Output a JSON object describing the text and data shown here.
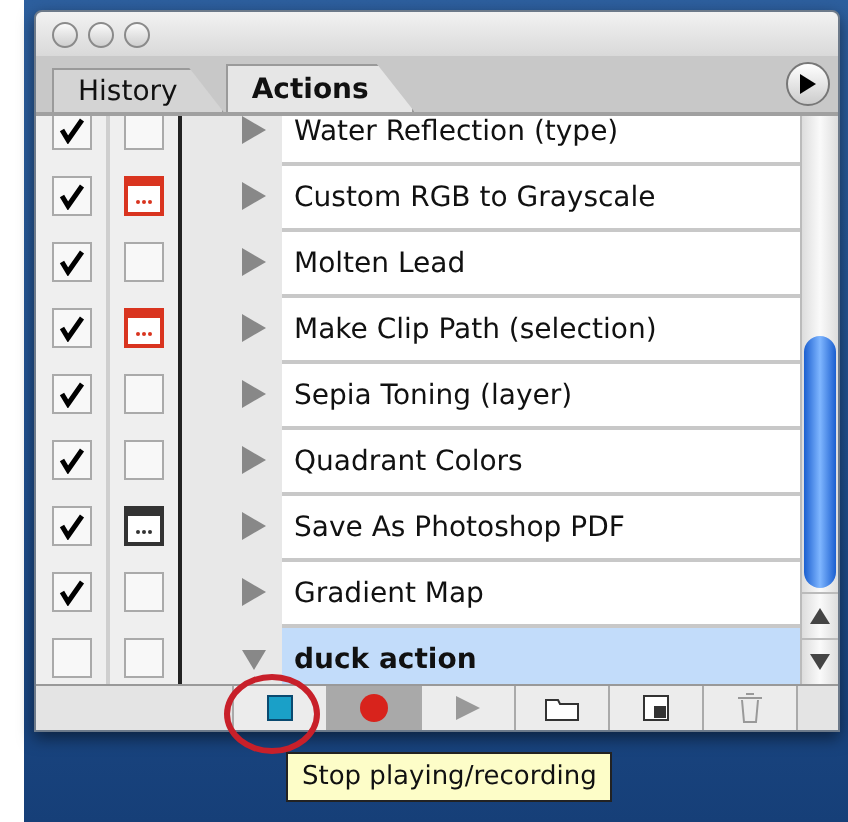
{
  "tabs": [
    {
      "label": "History",
      "selected": false
    },
    {
      "label": "Actions",
      "selected": true
    }
  ],
  "actions": [
    {
      "name": "Water Reflection (type)",
      "checked": true,
      "dialog": false,
      "expanded": false,
      "selected": false
    },
    {
      "name": "Custom RGB to Grayscale",
      "checked": true,
      "dialog": true,
      "color": "#d9341f",
      "expanded": false,
      "selected": false
    },
    {
      "name": "Molten Lead",
      "checked": true,
      "dialog": false,
      "expanded": false,
      "selected": false
    },
    {
      "name": "Make Clip Path (selection)",
      "checked": true,
      "dialog": true,
      "color": "#d9341f",
      "expanded": false,
      "selected": false
    },
    {
      "name": "Sepia Toning (layer)",
      "checked": true,
      "dialog": false,
      "expanded": false,
      "selected": false
    },
    {
      "name": "Quadrant Colors",
      "checked": true,
      "dialog": false,
      "expanded": false,
      "selected": false
    },
    {
      "name": "Save As Photoshop PDF",
      "checked": true,
      "dialog": true,
      "color": "#333333",
      "expanded": false,
      "selected": false
    },
    {
      "name": "Gradient Map",
      "checked": true,
      "dialog": false,
      "expanded": false,
      "selected": false
    },
    {
      "name": "duck action",
      "checked": false,
      "dialog": false,
      "expanded": true,
      "selected": true
    }
  ],
  "toolbar": [
    {
      "kind": "stop",
      "pressed": false,
      "circled": true
    },
    {
      "kind": "record",
      "pressed": true,
      "circled": false
    },
    {
      "kind": "play",
      "pressed": false,
      "circled": false
    },
    {
      "kind": "folder",
      "pressed": false,
      "circled": false
    },
    {
      "kind": "new",
      "pressed": false,
      "circled": false
    },
    {
      "kind": "trash",
      "pressed": false,
      "circled": false
    }
  ],
  "tooltip": "Stop playing/recording"
}
